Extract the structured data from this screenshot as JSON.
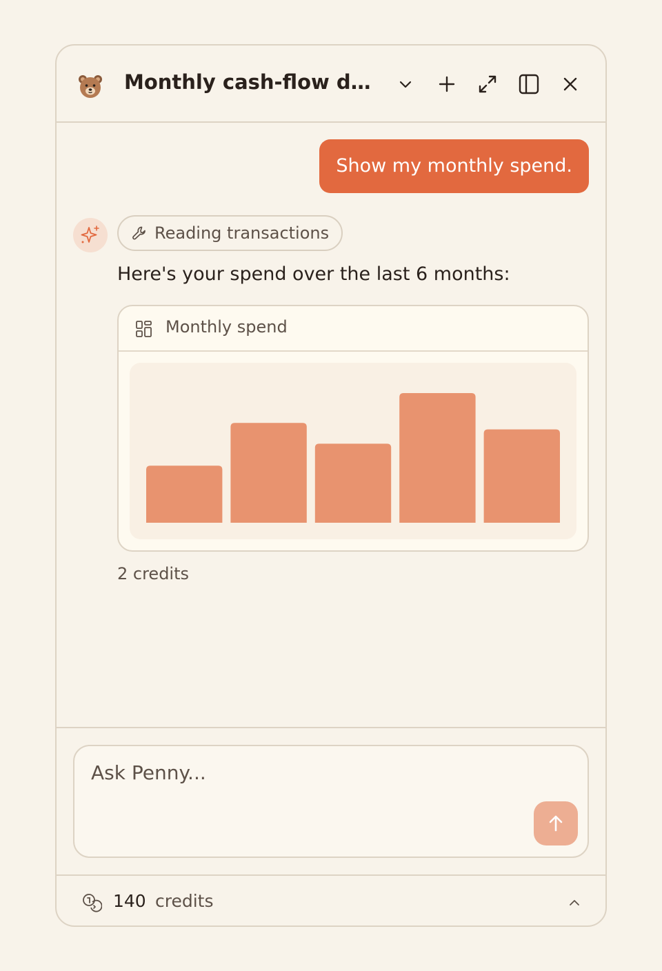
{
  "header": {
    "title": "Monthly cash-flow da…",
    "bear_icon": "bear-avatar-icon",
    "icons": [
      "chevron-down-icon",
      "plus-icon",
      "expand-icon",
      "sidebar-icon",
      "close-icon"
    ]
  },
  "conversation": {
    "user_message": "Show my monthly spend.",
    "tool_chip_label": "Reading transactions",
    "assistant_text": "Here's your spend over the last 6 months:",
    "card_title": "Monthly spend",
    "credits_used": "2 credits"
  },
  "chart_data": {
    "type": "bar",
    "values": [
      0.44,
      0.77,
      0.61,
      1.0,
      0.72
    ],
    "ylim": [
      0,
      1
    ],
    "bar_color": "#e8936f"
  },
  "composer": {
    "placeholder": "Ask Penny..."
  },
  "footer": {
    "credit_count": "140",
    "credit_label": "credits"
  },
  "colors": {
    "accent": "#e2693f",
    "background": "#f8f3ea",
    "border": "#ddd3c4",
    "send_button": "#edae93"
  }
}
